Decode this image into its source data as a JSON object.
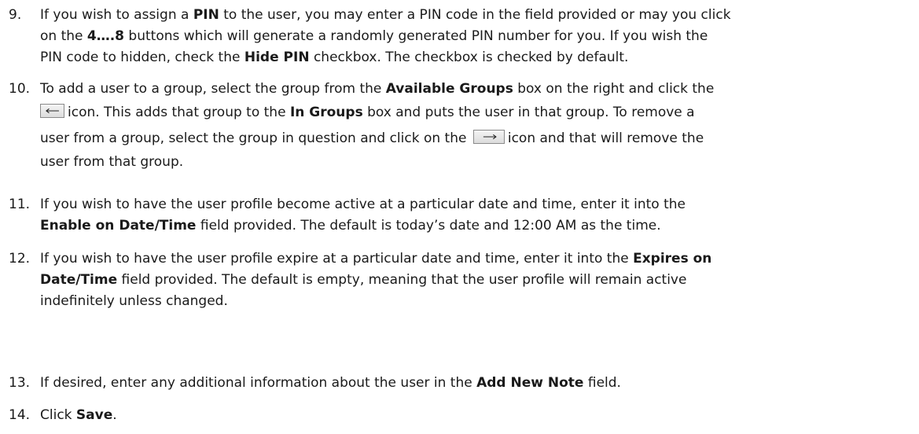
{
  "steps": [
    {
      "number": "9.",
      "lines": [
        [
          "If you wish to assign a ",
          {
            "b": "PIN"
          },
          " to the user, you may enter a PIN code in the field provided or may you click"
        ],
        [
          "on the ",
          {
            "b": "4….8"
          },
          " buttons which will generate a randomly generated PIN number for you. If you wish the"
        ],
        [
          "PIN code to hidden, check the ",
          {
            "b": "Hide PIN"
          },
          " checkbox. The checkbox is checked by default."
        ]
      ]
    },
    {
      "number": "10.",
      "lines": [
        [
          "To add a user to a group, select the group from the ",
          {
            "b": "Available Groups"
          },
          " box on the right and click the"
        ],
        [
          {
            "icon": "left-arrow-button-icon"
          },
          "icon. This adds that group to the ",
          {
            "b": "In Groups"
          },
          " box and puts the user in that group. To remove a"
        ],
        [
          "user from a group, select the group in question and click on the ",
          {
            "icon": "right-arrow-button-icon"
          },
          "icon and that will remove the"
        ],
        [
          "user from that group."
        ]
      ]
    },
    {
      "number": "11.",
      "lines": [
        [
          "If you wish to have the user profile become active at a particular date and time, enter it into the"
        ],
        [
          {
            "b": "Enable on Date/Time"
          },
          " field provided. The default is today’s date and 12:00 AM as the time."
        ]
      ]
    },
    {
      "number": "12.",
      "lines": [
        [
          "If you wish to have the user profile expire at a particular date and time, enter it into the ",
          {
            "b": "Expires on"
          }
        ],
        [
          {
            "b": "Date/Time"
          },
          " field provided. The default is empty, meaning that the user profile will remain active"
        ],
        [
          "indefinitely unless changed."
        ]
      ]
    },
    {
      "number": "13.",
      "lines": [
        [
          "If desired, enter any additional information about the user in the ",
          {
            "b": "Add New Note"
          },
          " field."
        ]
      ]
    },
    {
      "number": "14.",
      "lines": [
        [
          "Click ",
          {
            "b": "Save"
          },
          "."
        ]
      ]
    }
  ]
}
